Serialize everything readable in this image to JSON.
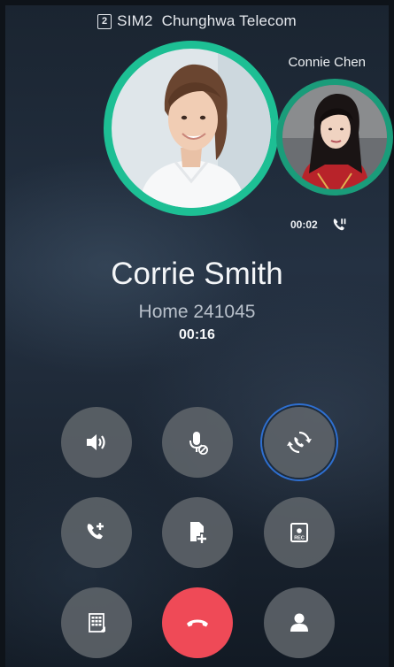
{
  "status": {
    "sim_label": "SIM2",
    "sim_number": "2",
    "carrier": "Chunghwa Telecom"
  },
  "active_call": {
    "name": "Corrie Smith",
    "number": "Home 241045",
    "duration": "00:16"
  },
  "held_call": {
    "name": "Connie Chen",
    "duration": "00:02"
  },
  "controls": [
    {
      "id": "speaker",
      "icon": "speaker-icon"
    },
    {
      "id": "mute",
      "icon": "mic-mute-icon"
    },
    {
      "id": "swap",
      "icon": "swap-call-icon",
      "active": true
    },
    {
      "id": "add-call",
      "icon": "add-call-icon"
    },
    {
      "id": "note",
      "icon": "add-note-icon"
    },
    {
      "id": "record",
      "icon": "record-icon"
    },
    {
      "id": "dialpad",
      "icon": "dialpad-icon"
    },
    {
      "id": "end-call",
      "icon": "end-call-icon"
    },
    {
      "id": "contacts",
      "icon": "contact-icon"
    }
  ],
  "colors": {
    "accent_ring": "#1dbf94",
    "end_call": "#ef4a57",
    "active_outline": "#2e6fd0"
  }
}
